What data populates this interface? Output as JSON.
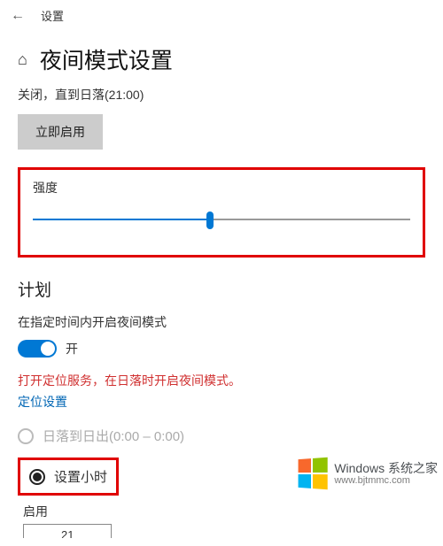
{
  "topbar": {
    "settings_label": "设置"
  },
  "header": {
    "page_title": "夜间模式设置"
  },
  "status": {
    "line": "关闭，直到日落(21:00)",
    "enable_now_button": "立即启用"
  },
  "intensity": {
    "label": "强度"
  },
  "plan": {
    "title": "计划",
    "schedule_desc": "在指定时间内开启夜间模式",
    "toggle_label": "开",
    "warning": "打开定位服务，在日落时开启夜间模式。",
    "location_link": "定位设置",
    "radio_sunset": "日落到日出(0:00 – 0:00)",
    "radio_sethours": "设置小时",
    "enable_label": "启用",
    "time_value": "21"
  },
  "watermark": {
    "line1_a": "Windows",
    "line1_b": "系统之家",
    "line2": "www.bjtmmc.com"
  }
}
